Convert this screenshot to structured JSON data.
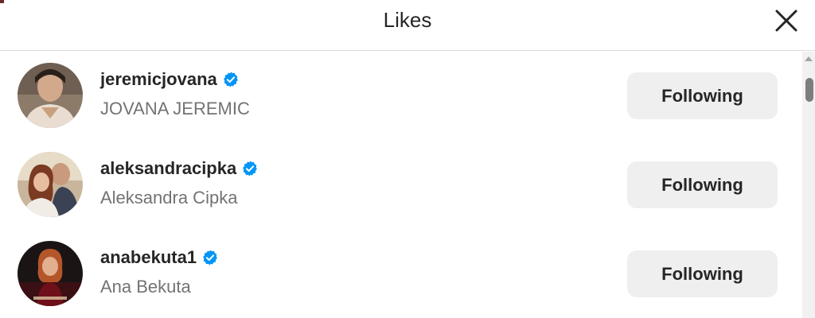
{
  "dialog": {
    "title": "Likes",
    "close_icon": "close-icon"
  },
  "users": [
    {
      "username": "jeremicjovana",
      "full_name": "JOVANA JEREMIC",
      "verified": true,
      "button_label": "Following"
    },
    {
      "username": "aleksandracipka",
      "full_name": "Aleksandra Cipka",
      "verified": true,
      "button_label": "Following"
    },
    {
      "username": "anabekuta1",
      "full_name": "Ana Bekuta",
      "verified": true,
      "button_label": "Following"
    }
  ],
  "colors": {
    "verified_badge": "#0095f6",
    "button_bg": "#efefef",
    "secondary_text": "#737373",
    "primary_text": "#262626"
  }
}
